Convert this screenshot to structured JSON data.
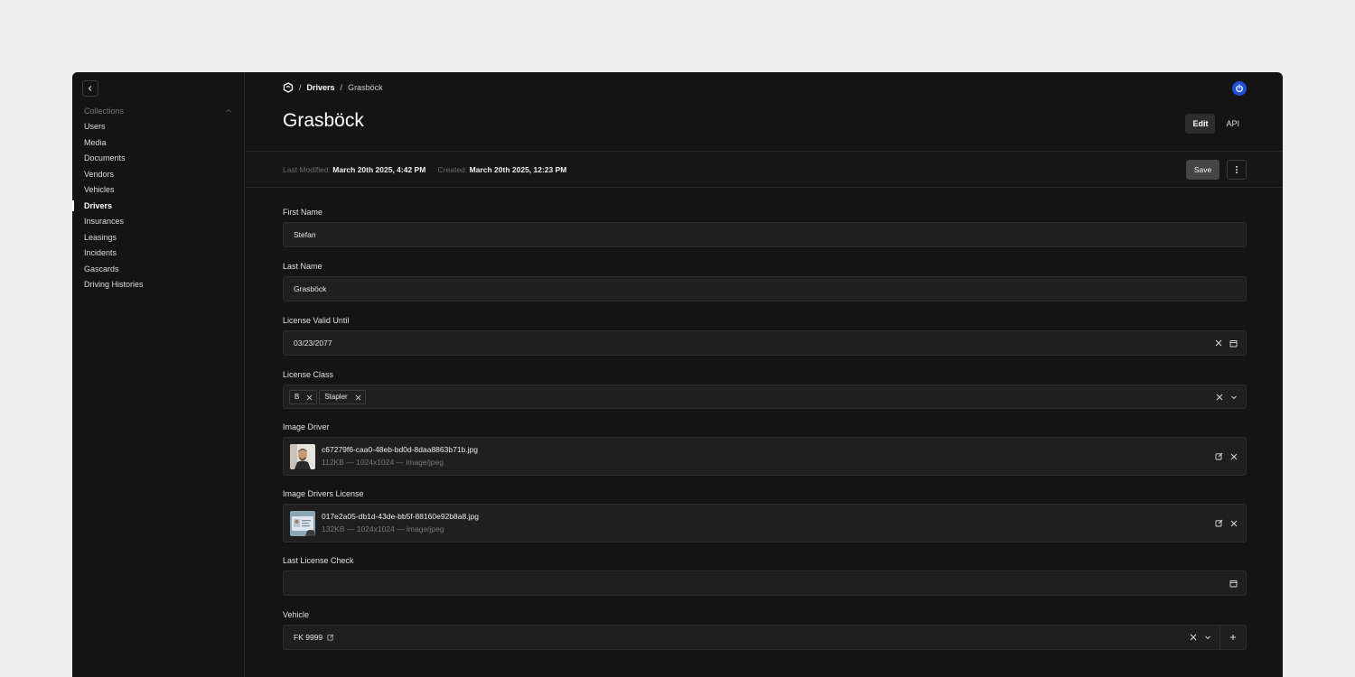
{
  "sidebar": {
    "section_title": "Collections",
    "items": [
      {
        "label": "Users"
      },
      {
        "label": "Media"
      },
      {
        "label": "Documents"
      },
      {
        "label": "Vendors"
      },
      {
        "label": "Vehicles"
      },
      {
        "label": "Drivers",
        "active": true
      },
      {
        "label": "Insurances"
      },
      {
        "label": "Leasings"
      },
      {
        "label": "Incidents"
      },
      {
        "label": "Gascards"
      },
      {
        "label": "Driving Histories"
      }
    ]
  },
  "breadcrumb": {
    "separator": "/",
    "collection": "Drivers",
    "current": "Grasböck"
  },
  "header": {
    "title": "Grasböck",
    "tabs": [
      {
        "label": "Edit",
        "active": true
      },
      {
        "label": "API"
      }
    ]
  },
  "meta": {
    "modified_label": "Last Modified:",
    "modified_value": "March 20th 2025, 4:42 PM",
    "created_label": "Created:",
    "created_value": "March 20th 2025, 12:23 PM",
    "save_label": "Save"
  },
  "fields": {
    "first_name": {
      "label": "First Name",
      "value": "Stefan"
    },
    "last_name": {
      "label": "Last Name",
      "value": "Grasböck"
    },
    "license_valid_until": {
      "label": "License Valid Until",
      "value": "03/23/2077"
    },
    "license_class": {
      "label": "License Class",
      "chips": [
        "B",
        "Stapler"
      ]
    },
    "image_driver": {
      "label": "Image Driver",
      "filename": "c67279f6-caa0-48eb-bd0d-8daa8863b71b.jpg",
      "meta": "112KB — 1024x1024 — image/jpeg"
    },
    "image_drivers_license": {
      "label": "Image Drivers License",
      "filename": "017e2a05-db1d-43de-bb5f-88160e92b8a8.jpg",
      "meta": "132KB — 1024x1024 — image/jpeg"
    },
    "last_license_check": {
      "label": "Last License Check",
      "value": ""
    },
    "vehicle": {
      "label": "Vehicle",
      "value": "FK 9999"
    }
  },
  "colors": {
    "background": "#efefef",
    "panel": "#141414",
    "input": "#1f1f1f",
    "accent": "#1e4fd6"
  },
  "icons": [
    "chevron-left-icon",
    "chevron-up-icon",
    "logo-icon",
    "power-icon",
    "more-vertical-icon",
    "close-icon",
    "calendar-icon",
    "chevron-down-icon",
    "edit-icon",
    "plus-icon"
  ]
}
